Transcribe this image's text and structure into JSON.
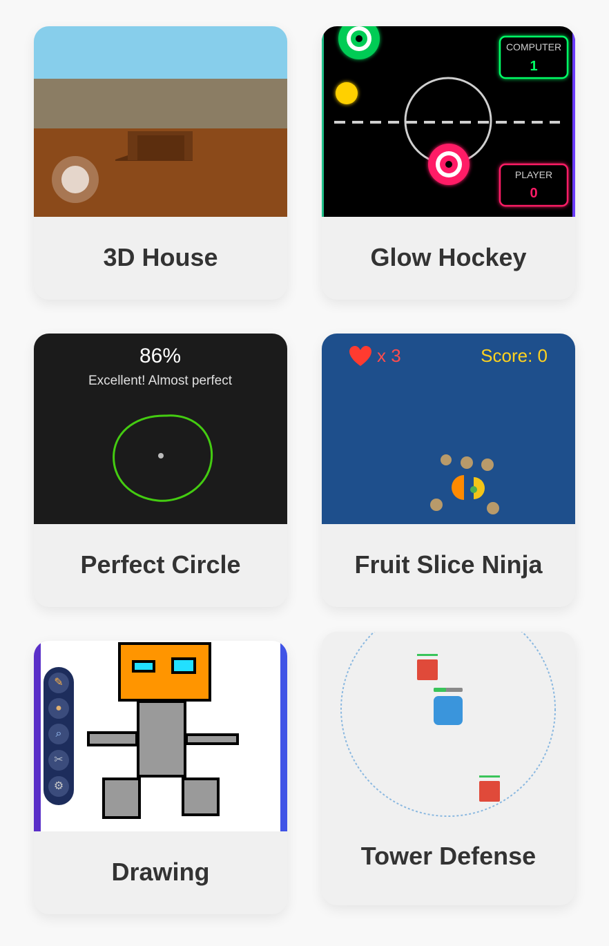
{
  "games": [
    {
      "title": "3D House"
    },
    {
      "title": "Glow Hockey",
      "hud": {
        "computer_label": "COMPUTER",
        "computer_score": "1",
        "player_label": "PLAYER",
        "player_score": "0"
      }
    },
    {
      "title": "Perfect Circle",
      "hud": {
        "percent": "86%",
        "message": "Excellent! Almost perfect"
      }
    },
    {
      "title": "Fruit Slice Ninja",
      "hud": {
        "lives_icon": "heart-icon",
        "lives": "x 3",
        "score": "Score: 0"
      }
    },
    {
      "title": "Drawing",
      "toolbar": [
        "pencil-icon",
        "palette-icon",
        "magnifier-icon",
        "scissors-icon",
        "gear-icon"
      ]
    },
    {
      "title": "Tower Defense"
    }
  ],
  "colors": {
    "card_bg": "#f0f0f0",
    "title_text": "#333333",
    "hockey_green": "#00ff66",
    "hockey_pink": "#ff1a66",
    "fruit_bg": "#1e4f8c",
    "score_yellow": "#ffd21f"
  }
}
